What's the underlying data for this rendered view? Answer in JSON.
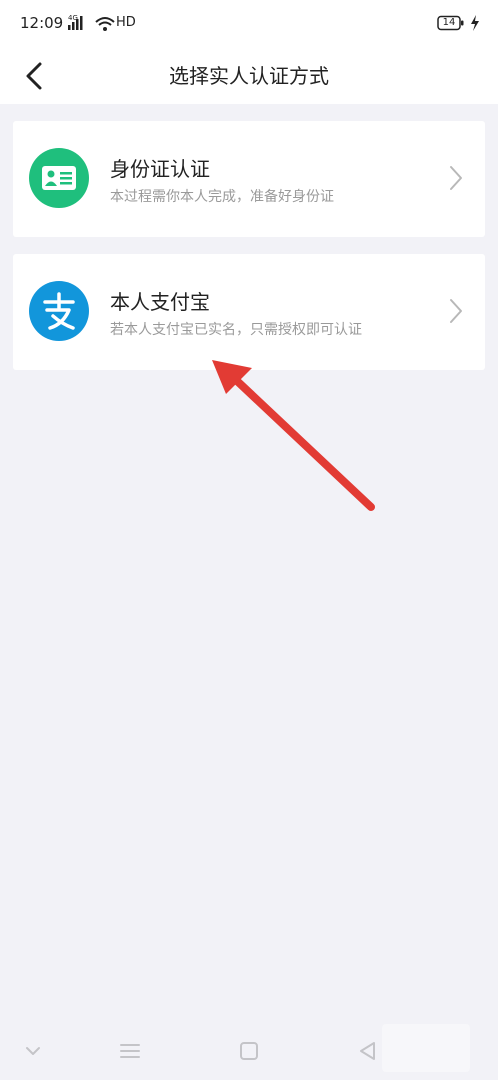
{
  "status_bar": {
    "time": "12:09",
    "network": "4G",
    "hd_label": "HD",
    "battery": "14"
  },
  "header": {
    "title": "选择实人认证方式"
  },
  "options": [
    {
      "title": "身份证认证",
      "subtitle": "本过程需你本人完成，准备好身份证",
      "icon": "id-card-icon",
      "icon_color": "#1fbf7d"
    },
    {
      "title": "本人支付宝",
      "subtitle": "若本人支付宝已实名，只需授权即可认证",
      "icon": "alipay-icon",
      "icon_color": "#1296db"
    }
  ],
  "colors": {
    "background": "#f2f2f7",
    "arrow": "#e23b34"
  }
}
